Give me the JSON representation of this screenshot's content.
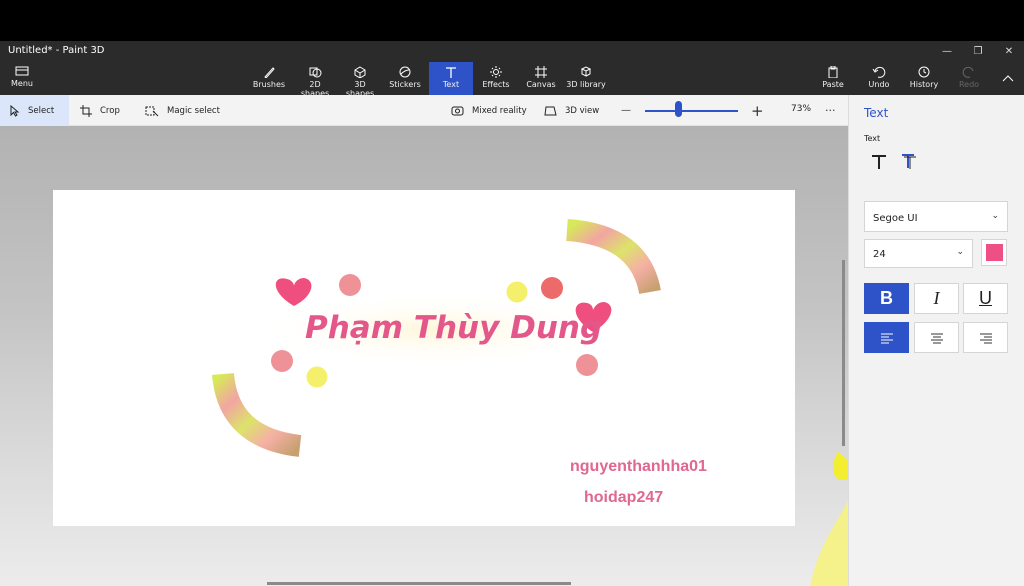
{
  "window": {
    "title": "Untitled* - Paint 3D",
    "minimize": "—",
    "restore": "❐",
    "close": "✕"
  },
  "ribbon": {
    "menu": "Menu",
    "tools": [
      {
        "label": "Brushes"
      },
      {
        "label": "2D shapes"
      },
      {
        "label": "3D shapes"
      },
      {
        "label": "Stickers"
      },
      {
        "label": "Text",
        "active": true
      },
      {
        "label": "Effects"
      },
      {
        "label": "Canvas"
      },
      {
        "label": "3D library"
      }
    ],
    "paste": "Paste",
    "undo": "Undo",
    "history": "History",
    "redo": "Redo"
  },
  "toolbar": {
    "select": "Select",
    "crop": "Crop",
    "magic_select": "Magic select",
    "mixed_reality": "Mixed reality",
    "view_3d": "3D view",
    "zoom_minus": "—",
    "zoom_plus": "+",
    "zoom_percent": "73%",
    "zoom_level": 0.35,
    "more": "···"
  },
  "canvas": {
    "main_text": "Phạm Thùy Dung",
    "text_1": "nguyenthanhha01",
    "text_2": "hoidap247"
  },
  "panel": {
    "title": "Text",
    "subtitle": "Text",
    "font": "Segoe UI",
    "size": "24",
    "color": "#ee4f84",
    "bold": "B",
    "italic": "I",
    "underline": "U",
    "bold_active": true,
    "align_left_active": true
  },
  "colors": {
    "accent": "#2e52c8",
    "pink_text": "#e3578a",
    "heart": "#ee4f7e",
    "yellow": "#f5f06b"
  }
}
